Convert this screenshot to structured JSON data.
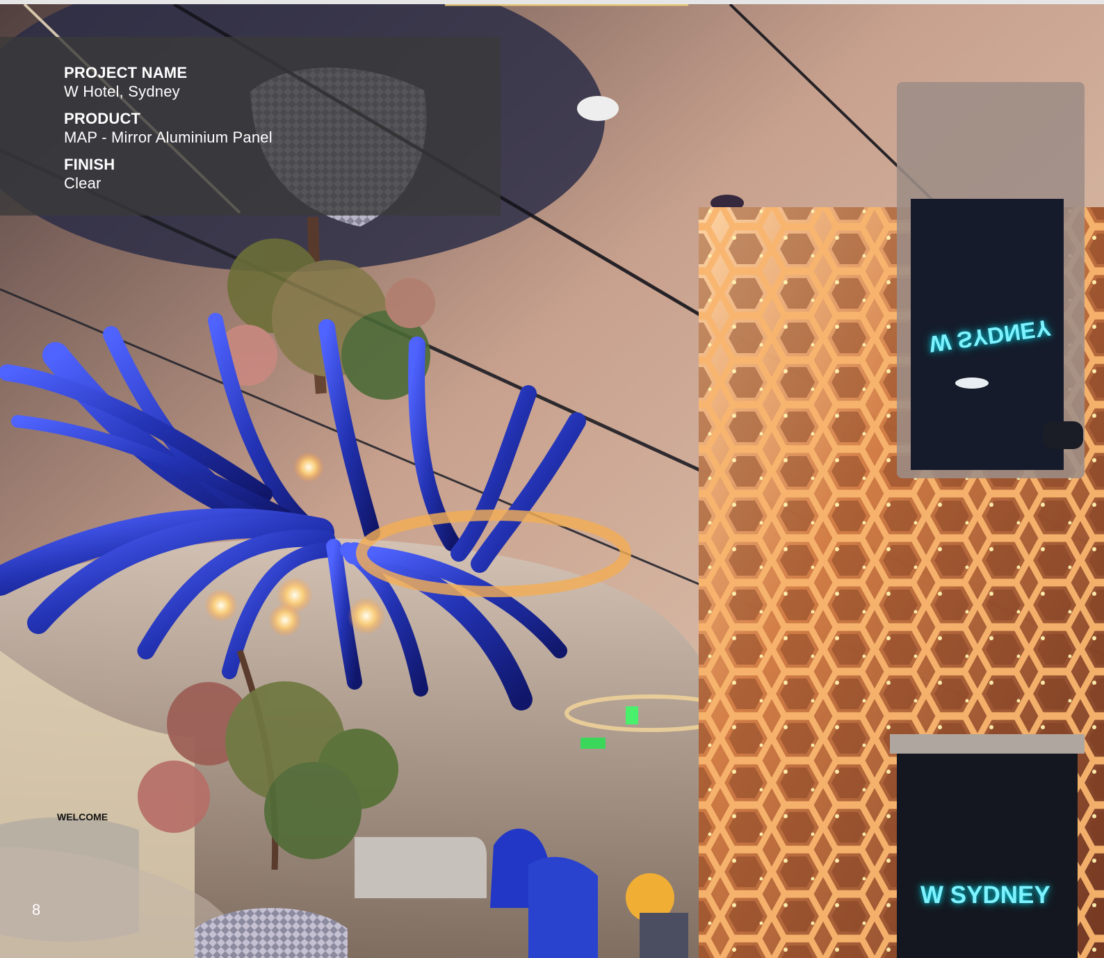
{
  "info_panel": {
    "project_name_label": "PROJECT NAME",
    "project_name_value": "W Hotel, Sydney",
    "product_label": "PRODUCT",
    "product_value": "MAP - Mirror Aluminium Panel",
    "finish_label": "FINISH",
    "finish_value": "Clear"
  },
  "signage": {
    "sign_top": "W SYDNEY",
    "sign_bottom": "W SYDNEY"
  },
  "page": {
    "number": "8"
  },
  "colors": {
    "panel_background": "#3a3a3a",
    "text": "#ffffff",
    "sign_text": "#7ef2ff",
    "copper": "#d88a52",
    "blue_sculpture": "#2b3bc8"
  }
}
